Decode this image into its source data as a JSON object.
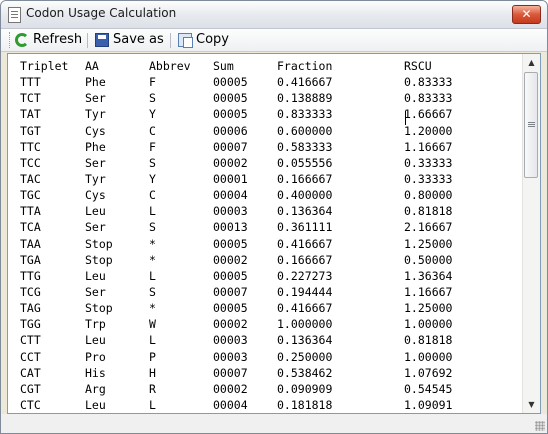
{
  "window": {
    "title": "Codon Usage Calculation",
    "close_glyph": "✕"
  },
  "toolbar": {
    "refresh_label": "Refresh",
    "save_label": "Save as",
    "copy_label": "Copy"
  },
  "table": {
    "headers": [
      "Triplet",
      "AA",
      "Abbrev",
      "Sum",
      "Fraction",
      "RSCU"
    ],
    "rows": [
      [
        "TTT",
        "Phe",
        "F",
        "00005",
        "0.416667",
        "0.83333"
      ],
      [
        "TCT",
        "Ser",
        "S",
        "00005",
        "0.138889",
        "0.83333"
      ],
      [
        "TAT",
        "Tyr",
        "Y",
        "00005",
        "0.833333",
        "1.66667"
      ],
      [
        "TGT",
        "Cys",
        "C",
        "00006",
        "0.600000",
        "1.20000"
      ],
      [
        "TTC",
        "Phe",
        "F",
        "00007",
        "0.583333",
        "1.16667"
      ],
      [
        "TCC",
        "Ser",
        "S",
        "00002",
        "0.055556",
        "0.33333"
      ],
      [
        "TAC",
        "Tyr",
        "Y",
        "00001",
        "0.166667",
        "0.33333"
      ],
      [
        "TGC",
        "Cys",
        "C",
        "00004",
        "0.400000",
        "0.80000"
      ],
      [
        "TTA",
        "Leu",
        "L",
        "00003",
        "0.136364",
        "0.81818"
      ],
      [
        "TCA",
        "Ser",
        "S",
        "00013",
        "0.361111",
        "2.16667"
      ],
      [
        "TAA",
        "Stop",
        "*",
        "00005",
        "0.416667",
        "1.25000"
      ],
      [
        "TGA",
        "Stop",
        "*",
        "00002",
        "0.166667",
        "0.50000"
      ],
      [
        "TTG",
        "Leu",
        "L",
        "00005",
        "0.227273",
        "1.36364"
      ],
      [
        "TCG",
        "Ser",
        "S",
        "00007",
        "0.194444",
        "1.16667"
      ],
      [
        "TAG",
        "Stop",
        "*",
        "00005",
        "0.416667",
        "1.25000"
      ],
      [
        "TGG",
        "Trp",
        "W",
        "00002",
        "1.000000",
        "1.00000"
      ],
      [
        "CTT",
        "Leu",
        "L",
        "00003",
        "0.136364",
        "0.81818"
      ],
      [
        "CCT",
        "Pro",
        "P",
        "00003",
        "0.250000",
        "1.00000"
      ],
      [
        "CAT",
        "His",
        "H",
        "00007",
        "0.538462",
        "1.07692"
      ],
      [
        "CGT",
        "Arg",
        "R",
        "00002",
        "0.090909",
        "0.54545"
      ],
      [
        "CTC",
        "Leu",
        "L",
        "00004",
        "0.181818",
        "1.09091"
      ]
    ]
  },
  "scrollbar": {
    "up_glyph": "▲",
    "down_glyph": "▼"
  }
}
